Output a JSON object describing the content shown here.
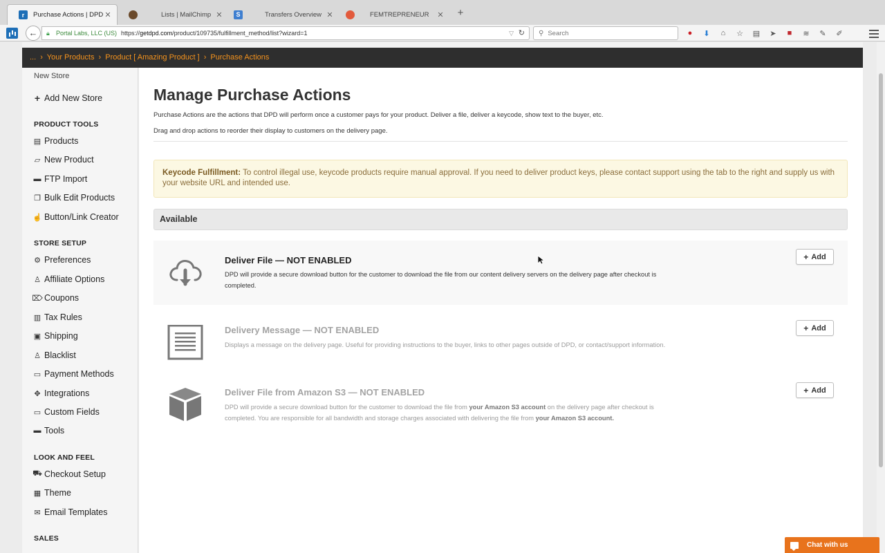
{
  "browser": {
    "tabs": [
      {
        "title": "Purchase Actions | DPD Sh...",
        "active": true
      },
      {
        "title": "Lists | MailChimp",
        "active": false
      },
      {
        "title": "Transfers Overview",
        "active": false
      },
      {
        "title": "FEMTREPRENEUR",
        "active": false
      }
    ],
    "new_tab": "+",
    "site_identity": "Portal Labs, LLC (US)",
    "url_prefix": "https://",
    "url_domain": "getdpd.com",
    "url_path": "/product/109735/fulfillment_method/list?wizard=1",
    "search_placeholder": "Search"
  },
  "breadcrumb": {
    "items": [
      "...",
      "Your Products",
      "Product [ Amazing Product ]",
      "Purchase Actions"
    ],
    "separator": "›"
  },
  "sidebar": {
    "store": "New Store",
    "add_store": "Add New Store",
    "sections": [
      {
        "heading": "PRODUCT TOOLS",
        "items": [
          "Products",
          "New Product",
          "FTP Import",
          "Bulk Edit Products",
          "Button/Link Creator"
        ]
      },
      {
        "heading": "STORE SETUP",
        "items": [
          "Preferences",
          "Affiliate Options",
          "Coupons",
          "Tax Rules",
          "Shipping",
          "Blacklist",
          "Payment Methods",
          "Integrations",
          "Custom Fields",
          "Tools"
        ]
      },
      {
        "heading": "LOOK AND FEEL",
        "items": [
          "Checkout Setup",
          "Theme",
          "Email Templates"
        ]
      },
      {
        "heading": "SALES",
        "items": []
      }
    ]
  },
  "main": {
    "title": "Manage Purchase Actions",
    "intro1": "Purchase Actions are the actions that DPD will perform once a customer pays for your product. Deliver a file, deliver a keycode, show text to the buyer, etc.",
    "intro2": "Drag and drop actions to reorder their display to customers on the delivery page.",
    "alert_bold": "Keycode Fulfillment:",
    "alert_text": " To control illegal use, keycode products require manual approval. If you need to deliver product keys, please contact support using the tab to the right and supply us with your website URL and intended use.",
    "available_heading": "Available",
    "add_label": "Add",
    "actions": [
      {
        "title": "Deliver File — NOT ENABLED",
        "desc": "DPD will provide a secure download button for the customer to download the file from our content delivery servers on the delivery page after checkout is completed."
      },
      {
        "title": "Delivery Message — NOT ENABLED",
        "desc": "Displays a message on the delivery page. Useful for providing instructions to the buyer, links to other pages outside of DPD, or contact/support information."
      },
      {
        "title": "Deliver File from Amazon S3 — NOT ENABLED",
        "desc_parts": [
          "DPD will provide a secure download button for the customer to download the file from ",
          "your Amazon S3 account",
          " on the delivery page after checkout is completed. You are responsible for all bandwidth and storage charges associated with delivering the file from ",
          "your Amazon S3 account."
        ]
      }
    ]
  },
  "chat": {
    "label": "Chat with us"
  },
  "colors": {
    "accent_orange": "#f7941d",
    "chat_orange": "#e8731c",
    "dark_bar": "#2e2e2e",
    "alert_bg": "#fcf8e3"
  }
}
